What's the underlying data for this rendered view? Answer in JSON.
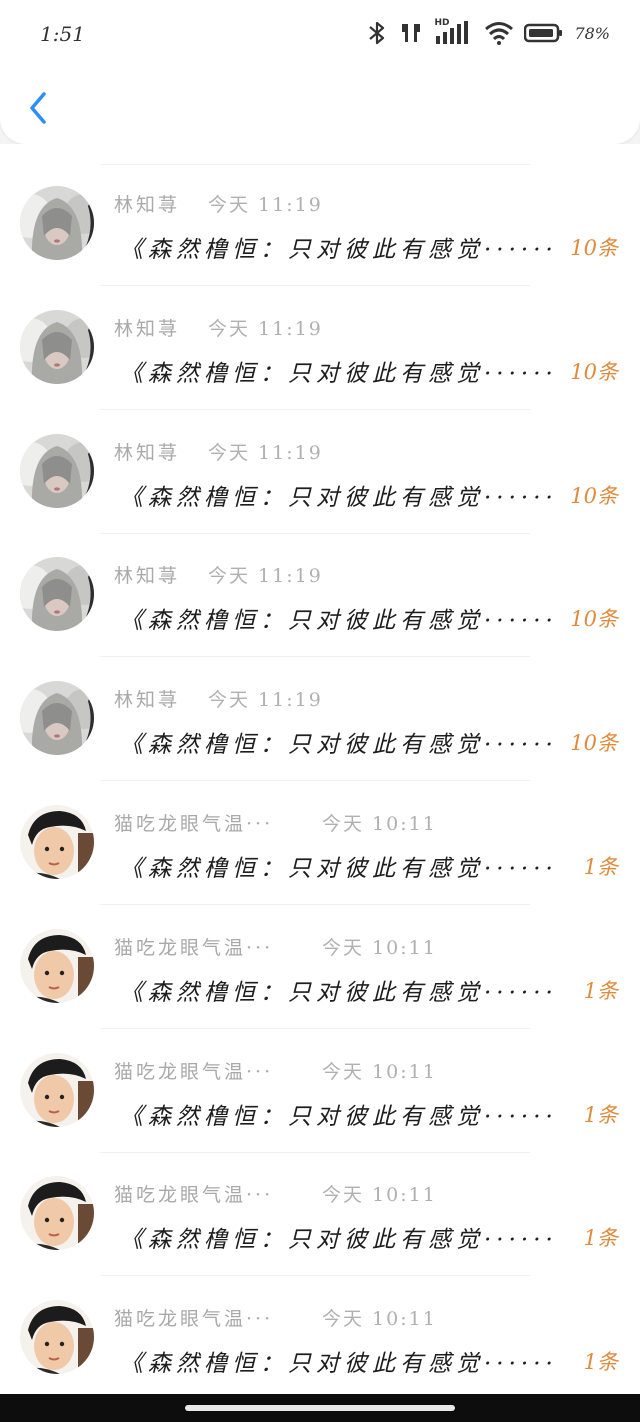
{
  "status_bar": {
    "time": "1:51",
    "battery_pct": "78%",
    "network_label": "HD",
    "icons": [
      "bluetooth-icon",
      "earbuds-icon",
      "signal-icon",
      "wifi-icon",
      "battery-icon"
    ]
  },
  "header": {
    "back_icon": "chevron-left-icon",
    "accent_color": "#2a8ff7"
  },
  "messages": [
    {
      "name": "林知荨",
      "time": "今天 11:19",
      "text": "《森然橹恒：只对彼此有感觉······",
      "count": "10条",
      "avatar": "avatar-grey-hair"
    },
    {
      "name": "林知荨",
      "time": "今天 11:19",
      "text": "《森然橹恒：只对彼此有感觉······",
      "count": "10条",
      "avatar": "avatar-grey-hair"
    },
    {
      "name": "林知荨",
      "time": "今天 11:19",
      "text": "《森然橹恒：只对彼此有感觉······",
      "count": "10条",
      "avatar": "avatar-grey-hair"
    },
    {
      "name": "林知荨",
      "time": "今天 11:19",
      "text": "《森然橹恒：只对彼此有感觉······",
      "count": "10条",
      "avatar": "avatar-grey-hair"
    },
    {
      "name": "林知荨",
      "time": "今天 11:19",
      "text": "《森然橹恒：只对彼此有感觉······",
      "count": "10条",
      "avatar": "avatar-grey-hair"
    },
    {
      "name": "猫吃龙眼气温···",
      "time": "今天 10:11",
      "text": "《森然橹恒：只对彼此有感觉······",
      "count": "1条",
      "avatar": "avatar-boy-cap"
    },
    {
      "name": "猫吃龙眼气温···",
      "time": "今天 10:11",
      "text": "《森然橹恒：只对彼此有感觉······",
      "count": "1条",
      "avatar": "avatar-boy-cap"
    },
    {
      "name": "猫吃龙眼气温···",
      "time": "今天 10:11",
      "text": "《森然橹恒：只对彼此有感觉······",
      "count": "1条",
      "avatar": "avatar-boy-cap"
    },
    {
      "name": "猫吃龙眼气温···",
      "time": "今天 10:11",
      "text": "《森然橹恒：只对彼此有感觉······",
      "count": "1条",
      "avatar": "avatar-boy-cap"
    },
    {
      "name": "猫吃龙眼气温···",
      "time": "今天 10:11",
      "text": "《森然橹恒：只对彼此有感觉······",
      "count": "1条",
      "avatar": "avatar-boy-cap"
    }
  ],
  "colors": {
    "count": "#e08a3c",
    "name": "#a9a9a9",
    "message": "#1e1e1e"
  }
}
